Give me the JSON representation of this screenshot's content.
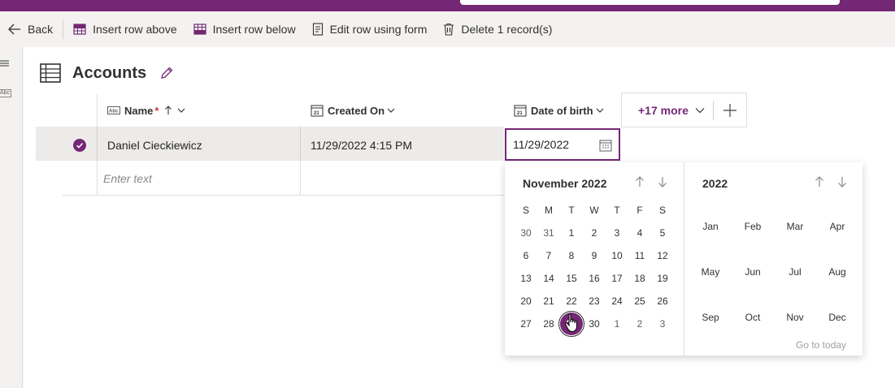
{
  "toolbar": {
    "back_label": "Back",
    "insert_above_label": "Insert row above",
    "insert_below_label": "Insert row below",
    "edit_form_label": "Edit row using form",
    "delete_label": "Delete 1 record(s)"
  },
  "table": {
    "title": "Accounts",
    "columns": {
      "name": "Name",
      "name_required": "*",
      "created_on": "Created On",
      "date_of_birth": "Date of birth"
    },
    "more_label": "+17 more",
    "rows": [
      {
        "name": "Daniel Cieckiewicz",
        "created_on": "11/29/2022 4:15 PM",
        "date_of_birth": "11/29/2022"
      }
    ],
    "new_row_placeholder": "Enter text"
  },
  "calendar": {
    "month_title": "November 2022",
    "year_title": "2022",
    "weekdays": [
      "S",
      "M",
      "T",
      "W",
      "T",
      "F",
      "S"
    ],
    "weeks": [
      [
        "30",
        "31",
        "1",
        "2",
        "3",
        "4",
        "5"
      ],
      [
        "6",
        "7",
        "8",
        "9",
        "10",
        "11",
        "12"
      ],
      [
        "13",
        "14",
        "15",
        "16",
        "17",
        "18",
        "19"
      ],
      [
        "20",
        "21",
        "22",
        "23",
        "24",
        "25",
        "26"
      ],
      [
        "27",
        "28",
        "29",
        "30",
        "1",
        "2",
        "3"
      ]
    ],
    "selected_day": "29",
    "months": [
      "Jan",
      "Feb",
      "Mar",
      "Apr",
      "May",
      "Jun",
      "Jul",
      "Aug",
      "Sep",
      "Oct",
      "Nov",
      "Dec"
    ],
    "go_to_today": "Go to today"
  },
  "colors": {
    "accent": "#742774",
    "required": "#d13438"
  }
}
